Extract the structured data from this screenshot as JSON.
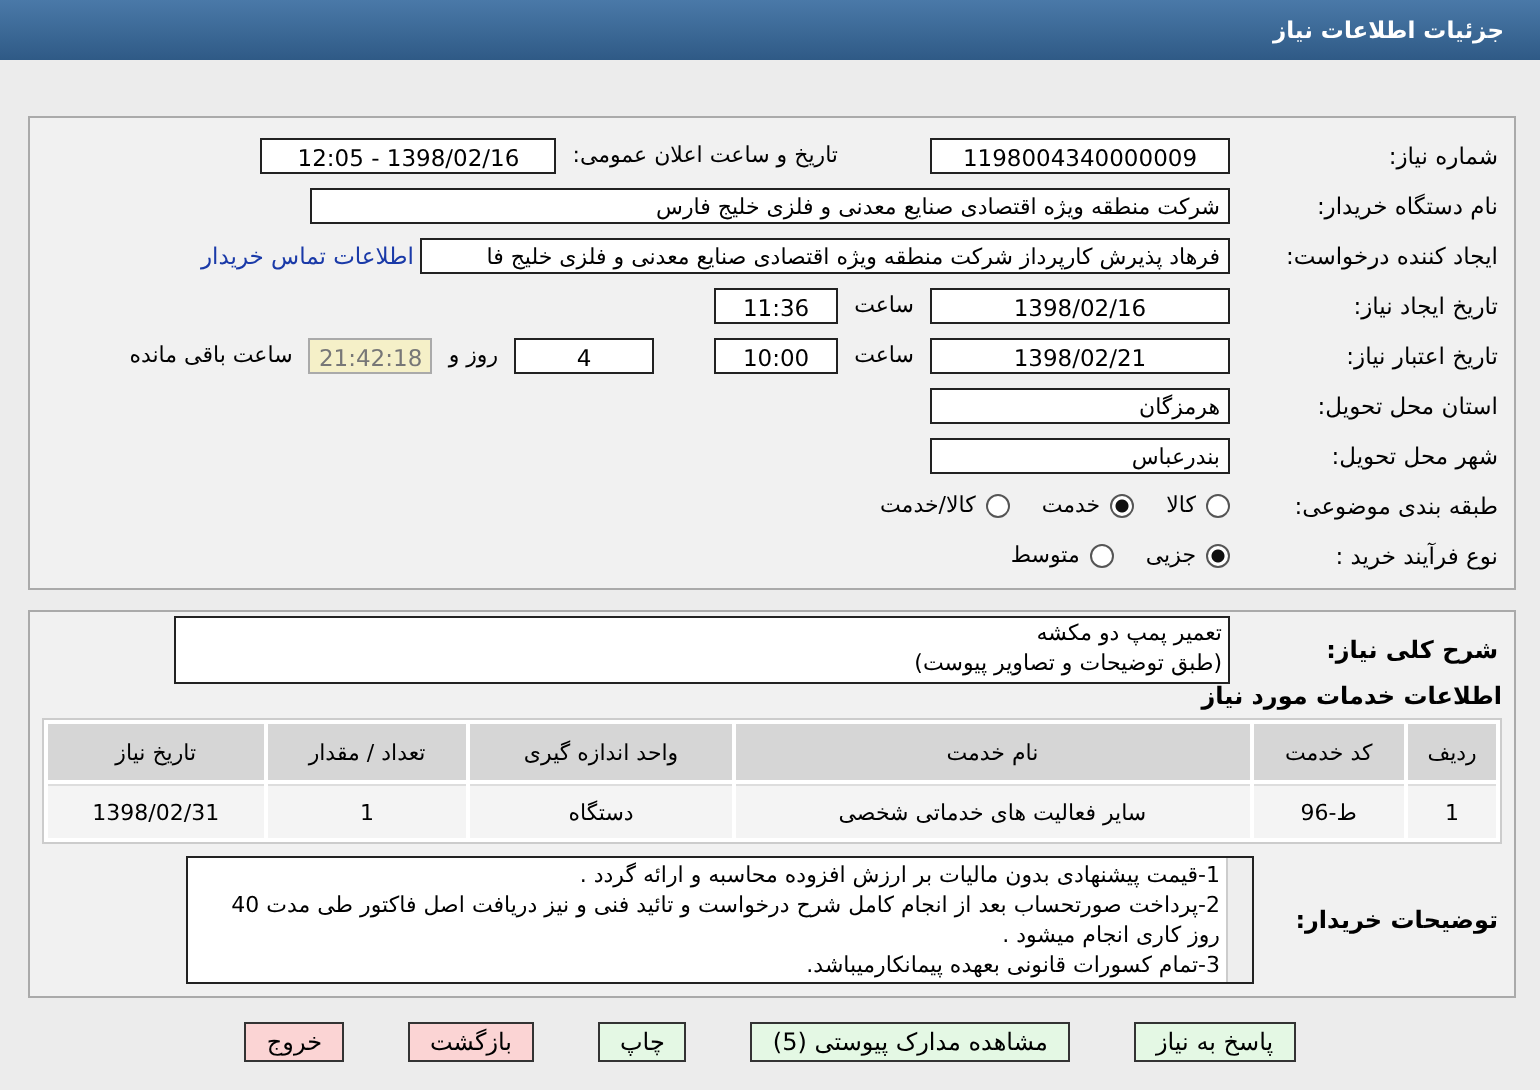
{
  "header": {
    "title": "جزئیات اطلاعات نیاز"
  },
  "need_number": {
    "label": "شماره نیاز:",
    "value": "1198004340000009"
  },
  "announce": {
    "label": "تاریخ و ساعت اعلان عمومی:",
    "value": "1398/02/16 - 12:05"
  },
  "buyer": {
    "label": "نام دستگاه خریدار:",
    "value": "شرکت منطقه ویژه اقتصادی صنایع معدنی و فلزی خلیج فارس"
  },
  "creator": {
    "label": "ایجاد کننده درخواست:",
    "value": "فرهاد پذیرش  کارپرداز شرکت منطقه ویژه اقتصادی صنایع معدنی و فلزی خلیج فا",
    "link": "اطلاعات تماس خریدار"
  },
  "created": {
    "label": "تاریخ ایجاد نیاز:",
    "date": "1398/02/16",
    "time_label": "ساعت",
    "time": "11:36"
  },
  "validity": {
    "label": "تاریخ اعتبار نیاز:",
    "date": "1398/02/21",
    "time_label": "ساعت",
    "time": "10:00",
    "days": "4",
    "days_label": "روز و",
    "remaining": "21:42:18",
    "remaining_label": "ساعت باقی مانده"
  },
  "province": {
    "label": "استان محل تحویل:",
    "value": "هرمزگان"
  },
  "city": {
    "label": "شهر محل تحویل:",
    "value": "بندرعباس"
  },
  "category": {
    "label": "طبقه بندی موضوعی:",
    "options": [
      {
        "label": "کالا",
        "selected": false
      },
      {
        "label": "خدمت",
        "selected": true
      },
      {
        "label": "کالا/خدمت",
        "selected": false
      }
    ]
  },
  "process": {
    "label": "نوع فرآیند خرید :",
    "options": [
      {
        "label": "جزیی",
        "selected": true
      },
      {
        "label": "متوسط",
        "selected": false
      }
    ]
  },
  "summary": {
    "label": "شرح کلی نیاز:",
    "lines": [
      "تعمیر پمپ دو مکشه",
      "(طبق توضیحات و تصاویر پیوست)"
    ]
  },
  "services": {
    "title": "اطلاعات خدمات مورد نیاز",
    "columns": [
      "ردیف",
      "کد خدمت",
      "نام خدمت",
      "واحد اندازه گیری",
      "تعداد / مقدار",
      "تاریخ نیاز"
    ],
    "rows": [
      [
        "1",
        "ط-96",
        "سایر فعالیت های خدماتی شخصی",
        "دستگاه",
        "1",
        "1398/02/31"
      ]
    ]
  },
  "notes": {
    "label": "توضیحات خریدار:",
    "lines": [
      "1-قیمت پیشنهادی بدون مالیات بر ارزش افزوده محاسبه و ارائه گردد .",
      "2-پرداخت صورتحساب بعد از انجام  کامل شرح درخواست  و تائید فنی و نیز دریافت اصل فاکتور طی مدت 40 روز کاری انجام میشود .",
      "3-تمام کسورات قانونی بعهده پیمانکارمیباشد."
    ]
  },
  "buttons": [
    {
      "label": "پاسخ به نیاز",
      "kind": "primary"
    },
    {
      "label": "مشاهده مدارک پیوستی (5)",
      "kind": "primary"
    },
    {
      "label": "چاپ",
      "kind": "primary"
    },
    {
      "label": "بازگشت",
      "kind": "danger"
    },
    {
      "label": "خروج",
      "kind": "danger"
    }
  ]
}
